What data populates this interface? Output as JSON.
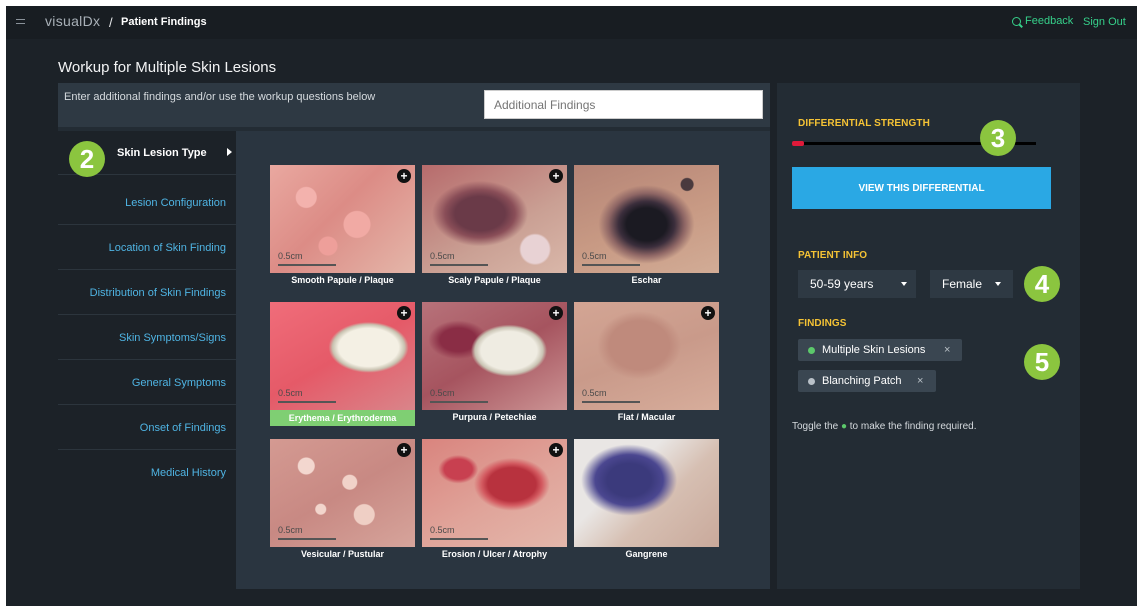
{
  "header": {
    "logo": "visualDx",
    "breadcrumb_sep": "/",
    "breadcrumb": "Patient Findings",
    "feedback": "Feedback",
    "sign_out": "Sign Out"
  },
  "page_title": "Workup for Multiple Skin Lesions",
  "findings": {
    "hint": "Enter additional findings and/or use the workup questions below",
    "placeholder": "Additional Findings"
  },
  "nav": {
    "items": [
      {
        "label": "Skin Lesion Type"
      },
      {
        "label": "Lesion Configuration"
      },
      {
        "label": "Location of Skin Finding"
      },
      {
        "label": "Distribution of Skin Findings"
      },
      {
        "label": "Skin Symptoms/Signs"
      },
      {
        "label": "General Symptoms"
      },
      {
        "label": "Onset of Findings"
      },
      {
        "label": "Medical History"
      }
    ]
  },
  "lesions": [
    {
      "label": "Smooth Papule / Plaque",
      "scale": "0.5cm",
      "plus": "+"
    },
    {
      "label": "Scaly Papule / Plaque",
      "scale": "0.5cm",
      "plus": "+"
    },
    {
      "label": "Eschar",
      "scale": "0.5cm",
      "plus": ""
    },
    {
      "label": "Erythema / Erythroderma",
      "scale": "0.5cm",
      "plus": "+"
    },
    {
      "label": "Purpura / Petechiae",
      "scale": "0.5cm",
      "plus": "+"
    },
    {
      "label": "Flat / Macular",
      "scale": "0.5cm",
      "plus": "+"
    },
    {
      "label": "Vesicular / Pustular",
      "scale": "0.5cm",
      "plus": "+"
    },
    {
      "label": "Erosion / Ulcer / Atrophy",
      "scale": "0.5cm",
      "plus": "+"
    },
    {
      "label": "Gangrene",
      "scale": "",
      "plus": ""
    }
  ],
  "differential": {
    "title": "DIFFERENTIAL STRENGTH",
    "strength": 0.05,
    "button": "VIEW THIS DIFFERENTIAL"
  },
  "patient_info": {
    "title": "PATIENT INFO",
    "age": "50-59 years",
    "sex": "Female"
  },
  "findings_list": {
    "title": "FINDINGS",
    "chips": [
      {
        "label": "Multiple Skin Lesions",
        "remove": "×",
        "dot_color": "#5cc96b"
      },
      {
        "label": "Blanching Patch",
        "remove": "×",
        "dot_color": "#b9c1c8"
      }
    ],
    "toggle_hint_pre": "Toggle the",
    "toggle_hint_dot": "●",
    "toggle_hint_post": "to make the finding required."
  },
  "steps": [
    "2",
    "3",
    "4",
    "5"
  ],
  "colors": {
    "accent_blue": "#2aa8e4",
    "section_yellow": "#f5c335",
    "step_green": "#8bc53f",
    "link_green": "#36d08a",
    "strength_red": "#e01a3a"
  }
}
